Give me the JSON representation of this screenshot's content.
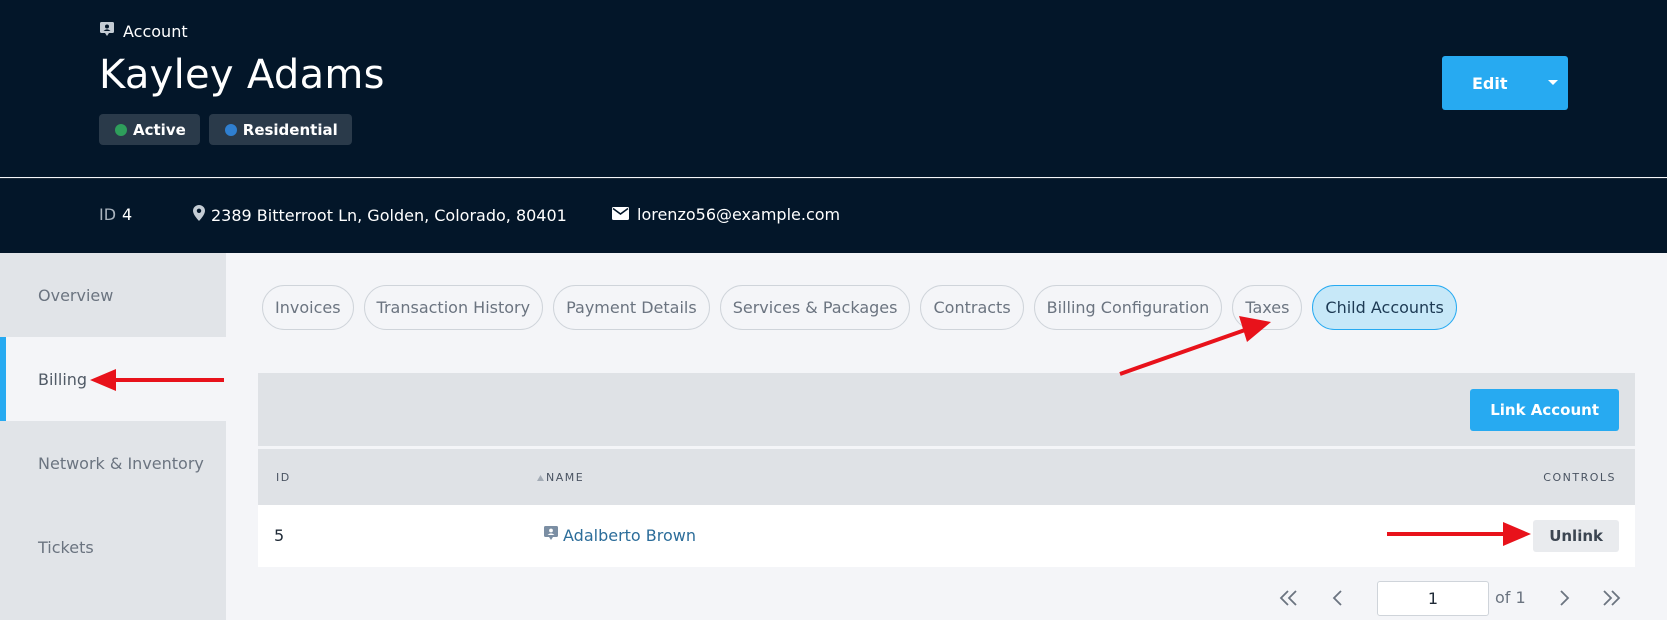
{
  "header": {
    "breadcrumb_label": "Account",
    "title": "Kayley Adams",
    "badges": [
      {
        "label": "Active",
        "color": "#2e9e5b"
      },
      {
        "label": "Residential",
        "color": "#2f7fd0"
      }
    ],
    "edit_label": "Edit"
  },
  "info": {
    "id_label": "ID",
    "id_value": "4",
    "address": "2389 Bitterroot Ln, Golden, Colorado, 80401",
    "email": "lorenzo56@example.com"
  },
  "sidebar": {
    "items": [
      {
        "label": "Overview"
      },
      {
        "label": "Billing"
      },
      {
        "label": "Network & Inventory"
      },
      {
        "label": "Tickets"
      }
    ],
    "active_index": 1
  },
  "tabs": [
    {
      "label": "Invoices"
    },
    {
      "label": "Transaction History"
    },
    {
      "label": "Payment Details"
    },
    {
      "label": "Services & Packages"
    },
    {
      "label": "Contracts"
    },
    {
      "label": "Billing Configuration"
    },
    {
      "label": "Taxes"
    },
    {
      "label": "Child Accounts"
    }
  ],
  "active_tab_index": 7,
  "toolbar": {
    "link_label": "Link Account"
  },
  "table": {
    "columns": {
      "id": "ID",
      "name": "NAME",
      "controls": "CONTROLS"
    },
    "rows": [
      {
        "id": "5",
        "name": "Adalberto Brown",
        "action": "Unlink"
      }
    ]
  },
  "pagination": {
    "page": "1",
    "of_label": "of 1"
  },
  "colors": {
    "accent": "#27aaf1",
    "header_bg": "#031629",
    "annotation_arrow": "#e8121b"
  }
}
